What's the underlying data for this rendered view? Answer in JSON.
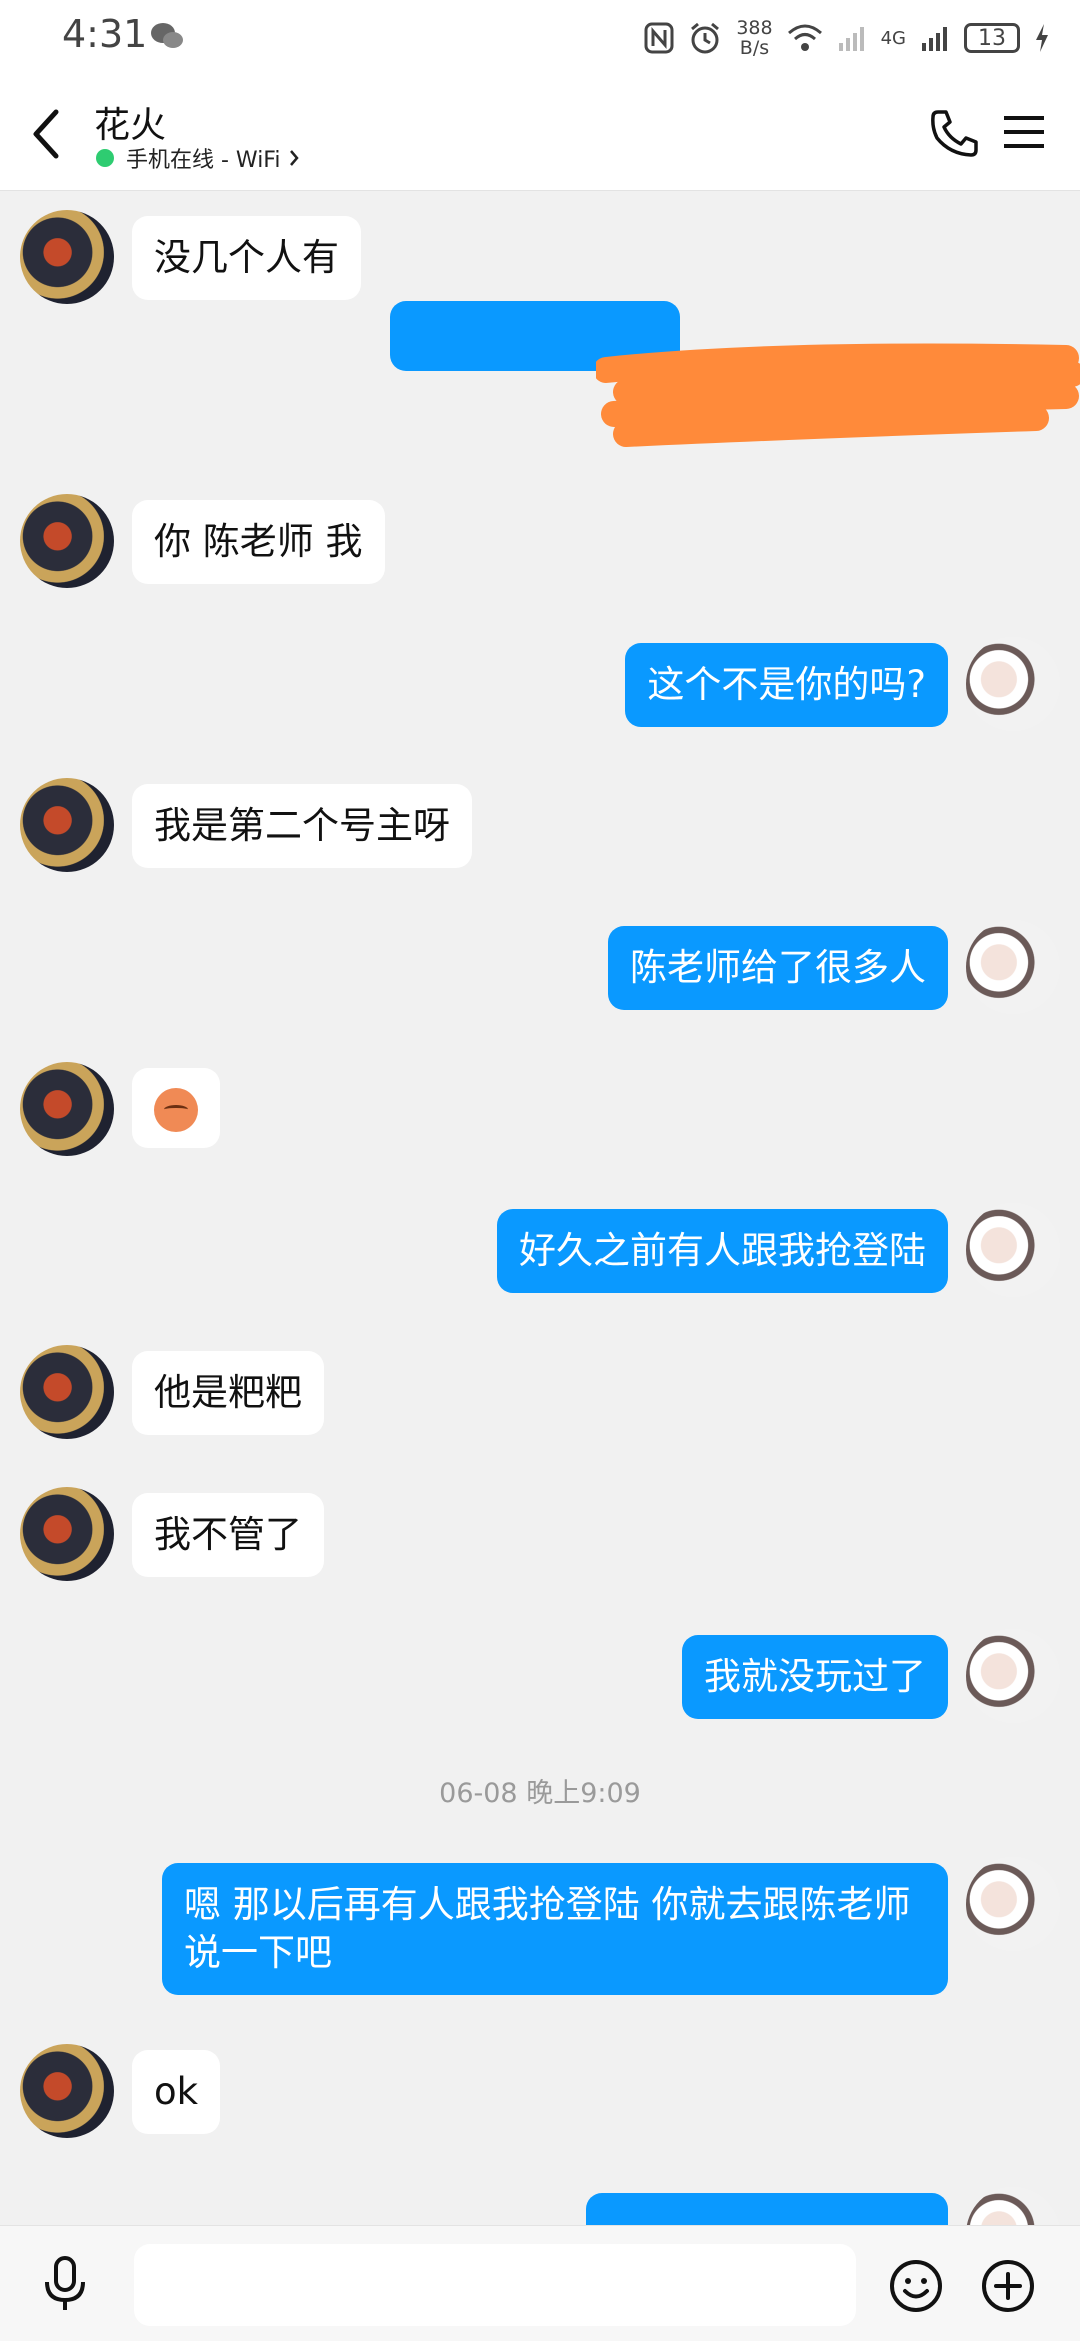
{
  "status_bar": {
    "time": "4:31",
    "net_speed_value": "388",
    "net_speed_unit": "B/s",
    "signal_label": "4G",
    "battery": "13",
    "icons": [
      "wechat-icon",
      "nfc-icon",
      "alarm-icon",
      "wifi-icon",
      "signal-icon",
      "battery-icon",
      "charging-icon"
    ]
  },
  "header": {
    "contact_name": "花火",
    "status_text": "手机在线 - WiFi",
    "status_color": "#2ecc71"
  },
  "colors": {
    "outgoing_bubble": "#0a99ff",
    "incoming_bubble": "#ffffff",
    "background": "#f1f1f1",
    "redaction": "#ff8a3a"
  },
  "messages": [
    {
      "side": "in",
      "text": "没几个人有"
    },
    {
      "side": "out",
      "text": "",
      "redacted": true
    },
    {
      "side": "in",
      "text": "你 陈老师 我"
    },
    {
      "side": "out",
      "text": "这个不是你的吗?"
    },
    {
      "side": "in",
      "text": "我是第二个号主呀"
    },
    {
      "side": "out",
      "text": "陈老师给了很多人"
    },
    {
      "side": "in",
      "emoji": "unamused-face-emoji"
    },
    {
      "side": "out",
      "text": "好久之前有人跟我抢登陆"
    },
    {
      "side": "in",
      "text": "他是粑粑"
    },
    {
      "side": "in",
      "text": "我不管了"
    },
    {
      "side": "out",
      "text": "我就没玩过了"
    },
    {
      "side": "out",
      "text": "嗯 那以后再有人跟我抢登陆 你就去跟陈老师说一下吧"
    },
    {
      "side": "in",
      "text": "ok"
    }
  ],
  "timestamp": "06-08 晚上9:09",
  "input_bar": {
    "placeholder": "",
    "icons": [
      "microphone-icon",
      "smiley-icon",
      "plus-icon"
    ]
  }
}
